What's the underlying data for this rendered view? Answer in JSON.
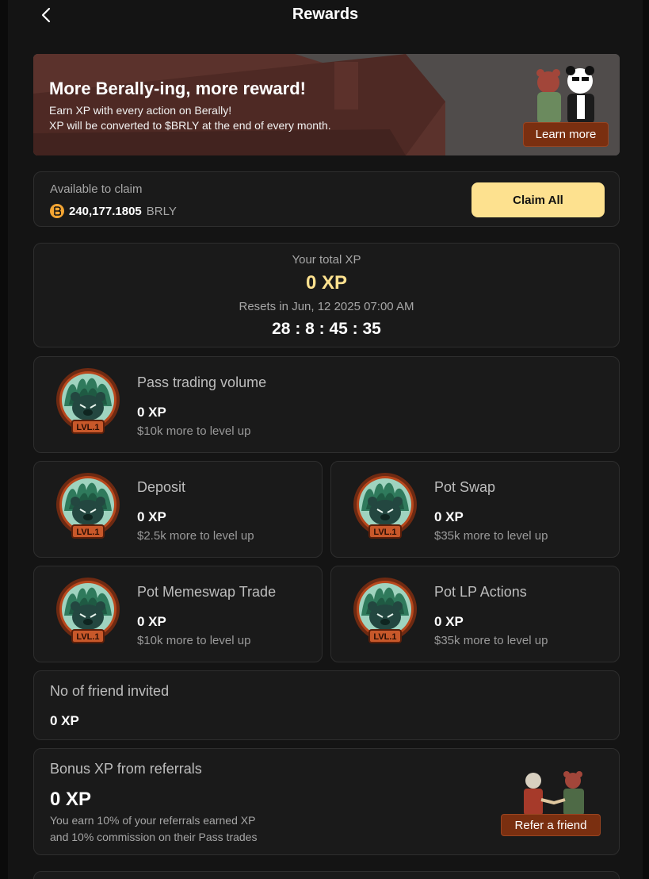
{
  "header": {
    "title": "Rewards"
  },
  "banner": {
    "title": "More Berally-ing, more reward!",
    "line1": "Earn XP with every action on Berally!",
    "line2": "XP will be converted to $BRLY at the end of every month.",
    "learn_more": "Learn more"
  },
  "claim": {
    "label": "Available to claim",
    "amount": "240,177.1805",
    "unit": "BRLY",
    "button": "Claim All",
    "coin_icon": "b"
  },
  "total": {
    "label": "Your total XP",
    "xp": "0 XP",
    "resets": "Resets in Jun, 12 2025 07:00 AM",
    "countdown": "28 : 8 : 45 : 35"
  },
  "badge_text": "LVL.1",
  "tasks": [
    {
      "title": "Pass trading volume",
      "xp": "0 XP",
      "sub": "$10k more to level up"
    },
    {
      "title": "Deposit",
      "xp": "0 XP",
      "sub": "$2.5k more to level up"
    },
    {
      "title": "Pot Swap",
      "xp": "0 XP",
      "sub": "$35k more to level up"
    },
    {
      "title": "Pot Memeswap Trade",
      "xp": "0 XP",
      "sub": "$10k more to level up"
    },
    {
      "title": "Pot LP Actions",
      "xp": "0 XP",
      "sub": "$35k more to level up"
    }
  ],
  "friends": {
    "title": "No of friend invited",
    "xp": "0 XP"
  },
  "bonus": {
    "title": "Bonus XP from referrals",
    "xp": "0 XP",
    "line1": "You earn 10% of your referrals earned XP",
    "line2": "and 10% commission on their Pass trades",
    "refer_button": "Refer a friend"
  },
  "colors": {
    "accent": "#fde18f",
    "brand_brown": "#7a2f10",
    "xp_gold": "#fde18f"
  }
}
